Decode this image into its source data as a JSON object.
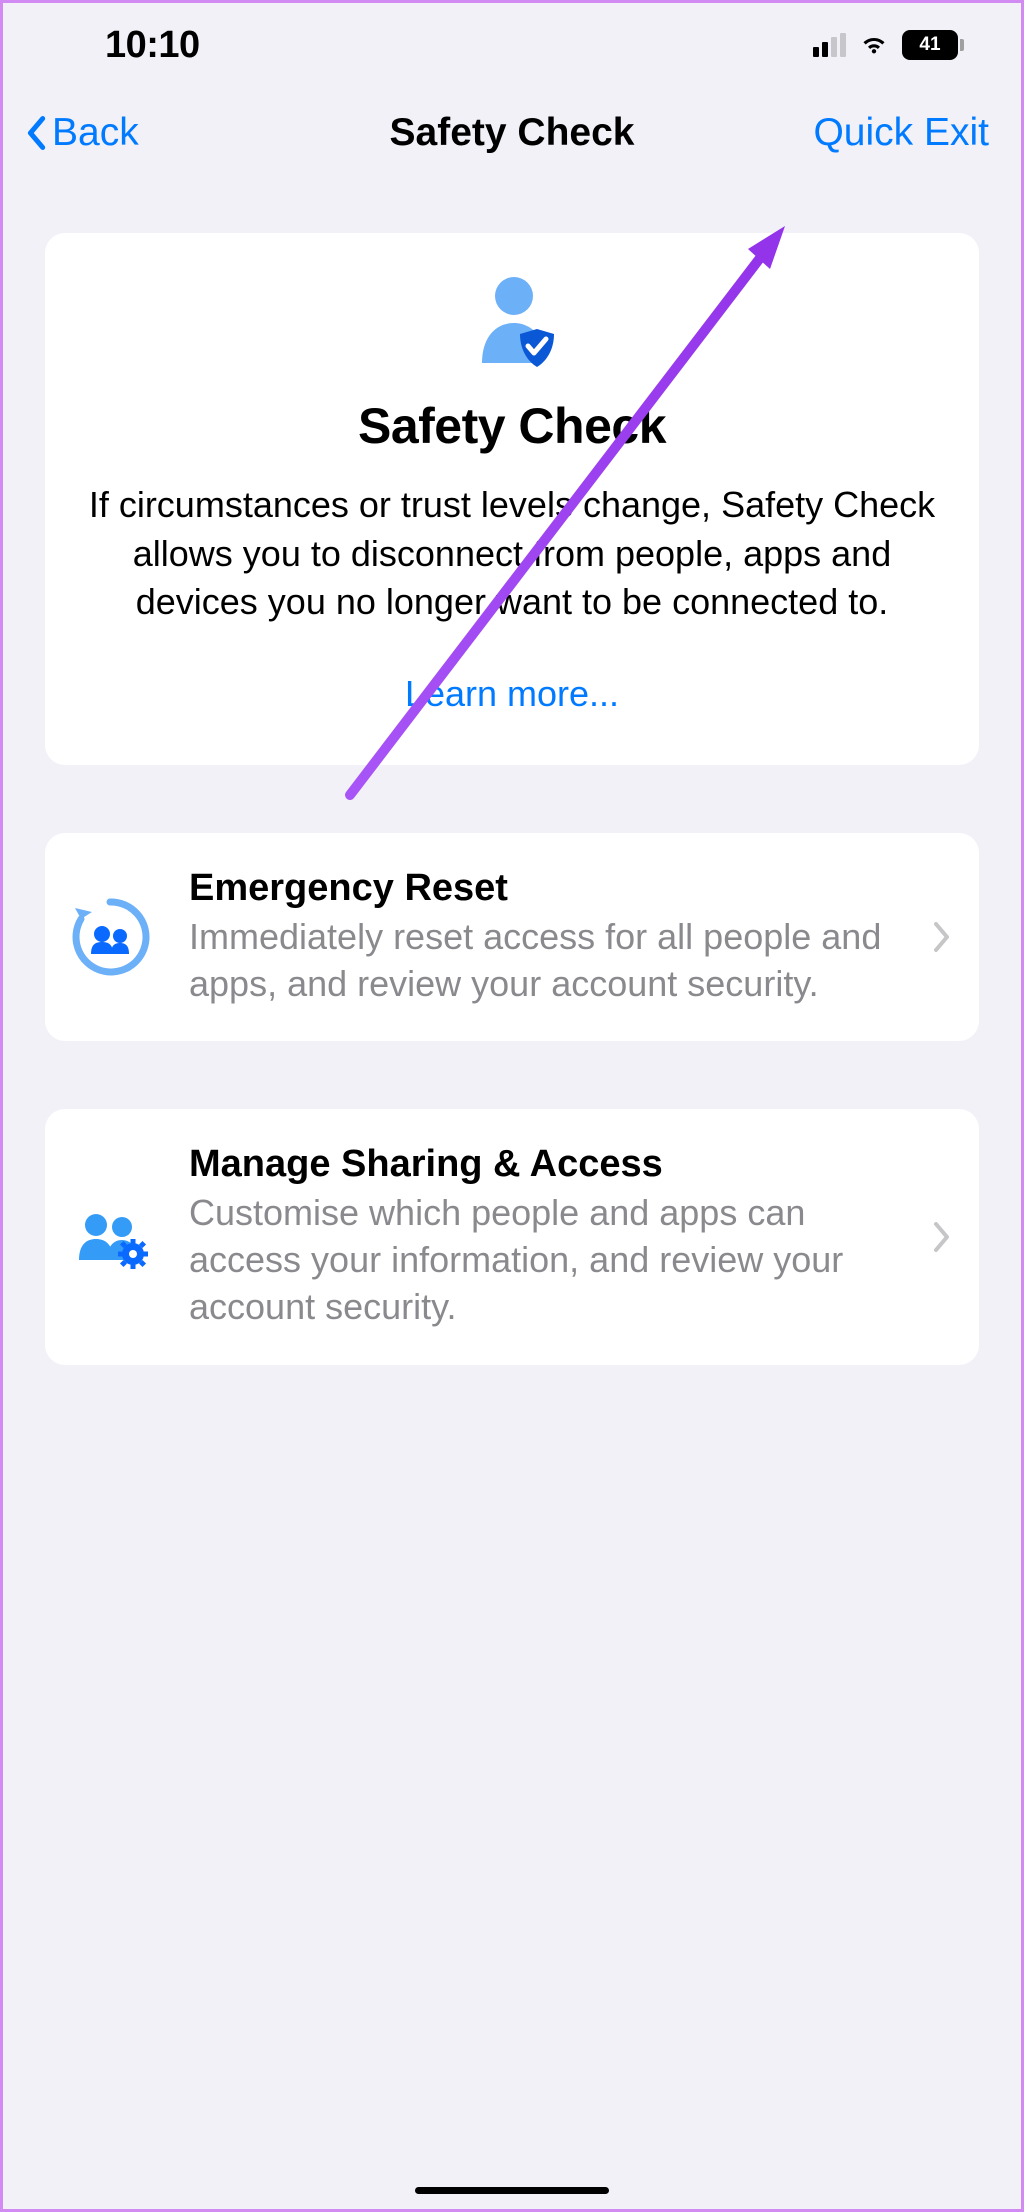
{
  "status": {
    "time": "10:10",
    "battery": "41"
  },
  "nav": {
    "back_label": "Back",
    "title": "Safety Check",
    "action_label": "Quick Exit"
  },
  "hero": {
    "title": "Safety Check",
    "description": "If circumstances or trust levels change, Safety Check allows you to disconnect from people, apps and devices you no longer want to be connected to.",
    "learn_more": "Learn more..."
  },
  "options": [
    {
      "title": "Emergency Reset",
      "description": "Immediately reset access for all people and apps, and review your account security."
    },
    {
      "title": "Manage Sharing & Access",
      "description": "Customise which people and apps can access your information, and review your account security."
    }
  ],
  "colors": {
    "accent": "#007aff",
    "icon_blue_light": "#6cb0f7",
    "icon_blue_dark": "#007aff",
    "text_secondary": "#8a8a8e",
    "bg": "#f2f1f7"
  }
}
